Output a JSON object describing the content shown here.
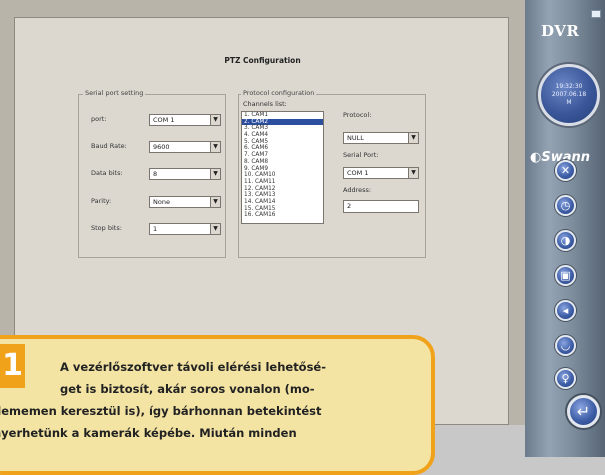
{
  "dialog": {
    "title": "PTZ Configuration",
    "serial": {
      "legend": "Serial port setting",
      "port_label": "port:",
      "port_value": "COM 1",
      "baud_label": "Baud Rate:",
      "baud_value": "9600",
      "data_label": "Data bits:",
      "data_value": "8",
      "parity_label": "Parity:",
      "parity_value": "None",
      "stop_label": "Stop bits:",
      "stop_value": "1"
    },
    "protocol": {
      "legend": "Protocol configuration",
      "channels_label": "Channels list:",
      "channels": [
        "1. CAM1",
        "2. CAM2",
        "3. CAM3",
        "4. CAM4",
        "5. CAM5",
        "6. CAM6",
        "7. CAM7",
        "8. CAM8",
        "9. CAM9",
        "10. CAM10",
        "11. CAM11",
        "12. CAM12",
        "13. CAM13",
        "14. CAM14",
        "15. CAM15",
        "16. CAM16"
      ],
      "selected_channel": "2. CAM2",
      "protocol_label": "Protocol:",
      "protocol_value": "NULL",
      "serial_port_label": "Serial Port:",
      "serial_port_value": "COM 1",
      "address_label": "Address:",
      "address_value": "2"
    }
  },
  "sidebar": {
    "logo": "DVR",
    "clock_time": "19:32:30",
    "clock_date": "2007.06.18",
    "clock_day": "M",
    "brand": "Swann",
    "buttons": [
      "tools-icon",
      "clock-icon",
      "contrast-icon",
      "screen-icon",
      "volume-icon",
      "ptz-icon",
      "key-icon"
    ],
    "back_icon": "return-arrow-icon"
  },
  "caption": {
    "number": "1",
    "lines": [
      "A vezérlőszoftver távoli elérési lehetősé-",
      "get is biztosít, akár soros vonalon (mo-",
      "dememen keresztül is), így bárhonnan betekintést",
      "nyerhetünk a kamerák képébe. Miután minden"
    ]
  },
  "colors": {
    "accent": "#f0a21a",
    "caption_bg": "#f3e4a4",
    "selection": "#2b4f9e"
  }
}
